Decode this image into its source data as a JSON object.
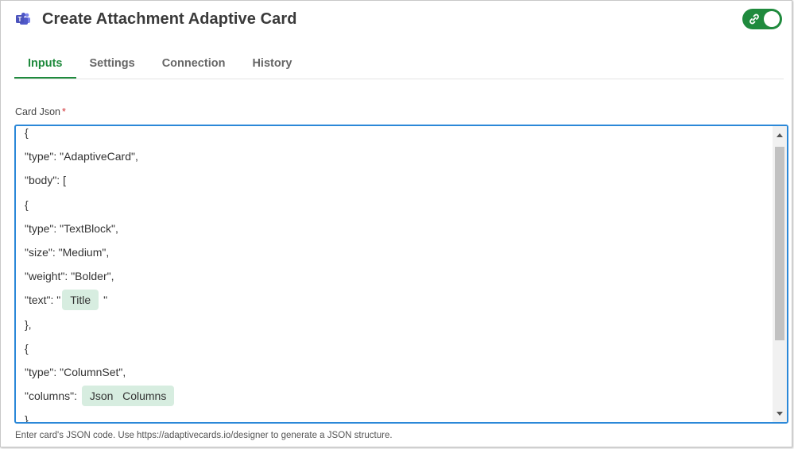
{
  "header": {
    "title": "Create Attachment Adaptive Card",
    "icon": "teams-icon",
    "toggle_icon": "link-icon",
    "accent": "#1f8a3d"
  },
  "tabs": [
    {
      "label": "Inputs",
      "active": true
    },
    {
      "label": "Settings",
      "active": false
    },
    {
      "label": "Connection",
      "active": false
    },
    {
      "label": "History",
      "active": false
    }
  ],
  "field": {
    "label": "Card Json",
    "required_mark": "*",
    "help_text": "Enter card's JSON code. Use https://adaptivecards.io/designer to generate a JSON structure."
  },
  "editor": {
    "lines": [
      {
        "text": "{"
      },
      {
        "text": "\"type\": \"AdaptiveCard\","
      },
      {
        "text": "\"body\": ["
      },
      {
        "text": "{"
      },
      {
        "text": "\"type\": \"TextBlock\","
      },
      {
        "text": "\"size\": \"Medium\","
      },
      {
        "text": "\"weight\": \"Bolder\","
      },
      {
        "text": "\"text\": \"",
        "chip": "Title",
        "suffix": " \""
      },
      {
        "text": "},"
      },
      {
        "text": "{"
      },
      {
        "text": "\"type\": \"ColumnSet\","
      },
      {
        "text": "\"columns\": ",
        "chip": "Json   Columns",
        "suffix": ""
      },
      {
        "text": "}"
      }
    ]
  }
}
